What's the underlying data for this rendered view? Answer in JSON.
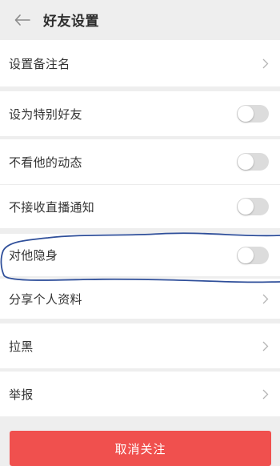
{
  "header": {
    "title": "好友设置",
    "back_icon": "arrow-left-icon"
  },
  "settings": {
    "remark": {
      "label": "设置备注名"
    },
    "special_friend": {
      "label": "设为特别好友",
      "enabled": false
    },
    "hide_his_updates": {
      "label": "不看他的动态",
      "enabled": false
    },
    "no_live_notifications": {
      "label": "不接收直播通知",
      "enabled": false
    },
    "invisible_to_him": {
      "label": "对他隐身",
      "enabled": false
    },
    "share_profile": {
      "label": "分享个人资料"
    },
    "block": {
      "label": "拉黑"
    },
    "report": {
      "label": "举报"
    }
  },
  "actions": {
    "unfollow_label": "取消关注"
  },
  "colors": {
    "page_background": "#eeeeee",
    "toggle_off": "#dcdcdc",
    "danger_button": "#f0504e",
    "annotation_ink": "#2f4f9a"
  }
}
